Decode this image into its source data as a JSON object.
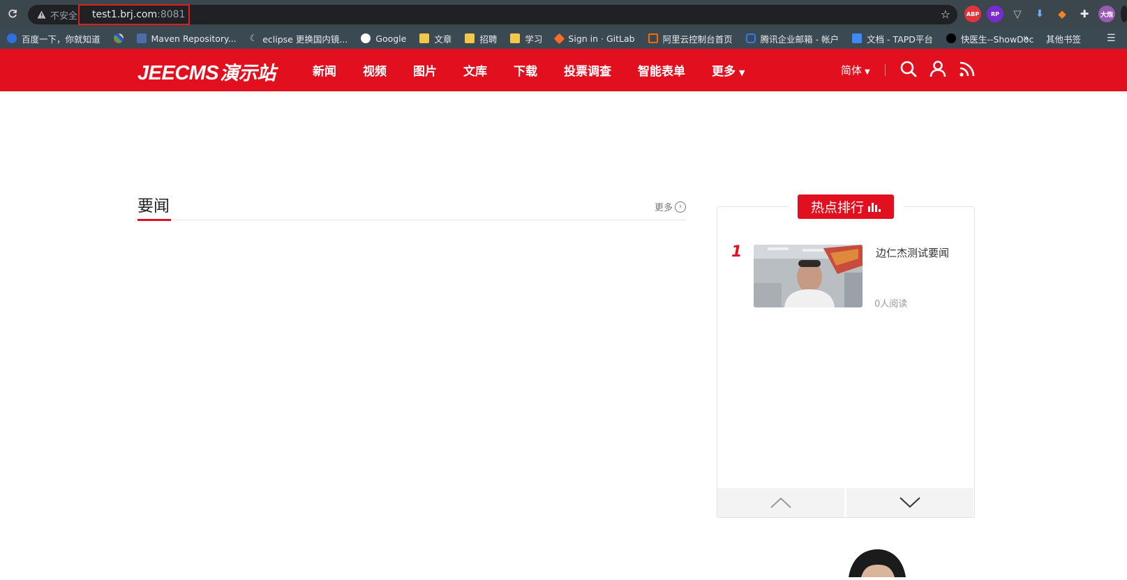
{
  "browser": {
    "insecure_label": "不安全",
    "url_host": "test1.brj.com",
    "url_port": ":8081",
    "extensions": {
      "abp": "ABP",
      "rp": "RP",
      "profile": "大炮"
    },
    "bookmarks": [
      {
        "label": "百度一下，你就知道",
        "icon": "baidu-icon"
      },
      {
        "label": "",
        "icon": "colorful-icon"
      },
      {
        "label": "Maven Repository...",
        "icon": "maven-icon"
      },
      {
        "label": "eclipse 更换国内镜...",
        "icon": "eclipse-icon"
      },
      {
        "label": "Google",
        "icon": "google-icon"
      },
      {
        "label": "文章",
        "icon": "folder-icon"
      },
      {
        "label": "招聘",
        "icon": "folder-icon"
      },
      {
        "label": "学习",
        "icon": "folder-icon"
      },
      {
        "label": "Sign in · GitLab",
        "icon": "gitlab-icon"
      },
      {
        "label": "阿里云控制台首页",
        "icon": "aliyun-icon"
      },
      {
        "label": "腾讯企业邮箱 - 帐户",
        "icon": "tencent-icon"
      },
      {
        "label": "文档 - TAPD平台",
        "icon": "tapd-icon"
      },
      {
        "label": "快医生--ShowDoc",
        "icon": "showdoc-icon"
      }
    ],
    "overflow": "»",
    "other_bookmarks": "其他书签"
  },
  "site": {
    "logo_en": "JEECMS",
    "logo_cn": "演示站",
    "nav": [
      "新闻",
      "视频",
      "图片",
      "文库",
      "下载",
      "投票调查",
      "智能表单",
      "更多"
    ],
    "lang": "简体",
    "accent": "#e2101f"
  },
  "news": {
    "title": "要闻",
    "more": "更多"
  },
  "hot": {
    "title": "热点排行",
    "items": [
      {
        "rank": "1",
        "title": "边仁杰测试要闻",
        "reads": "0人阅读"
      }
    ]
  }
}
